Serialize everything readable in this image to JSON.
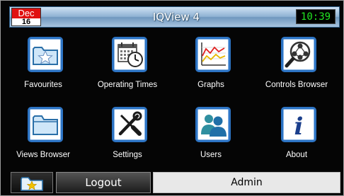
{
  "header": {
    "date_month": "Dec",
    "date_day": "16",
    "title": "IQView 4",
    "clock": "10:39"
  },
  "tiles": [
    {
      "label": "Favourites",
      "icon": "favourites-folder-star-icon"
    },
    {
      "label": "Operating Times",
      "icon": "calendar-clock-icon"
    },
    {
      "label": "Graphs",
      "icon": "line-graph-icon"
    },
    {
      "label": "Controls Browser",
      "icon": "magnifier-network-icon"
    },
    {
      "label": "Views Browser",
      "icon": "folder-icon"
    },
    {
      "label": "Settings",
      "icon": "screwdriver-wrench-icon"
    },
    {
      "label": "Users",
      "icon": "users-icon"
    },
    {
      "label": "About",
      "icon": "info-icon"
    }
  ],
  "footer": {
    "favourite_icon": "star-folder-icon",
    "logout_label": "Logout",
    "current_user": "Admin"
  },
  "colors": {
    "accent_blue": "#2d74c4",
    "clock_green": "#22e622",
    "date_red": "#e01010",
    "background": "#050505"
  }
}
